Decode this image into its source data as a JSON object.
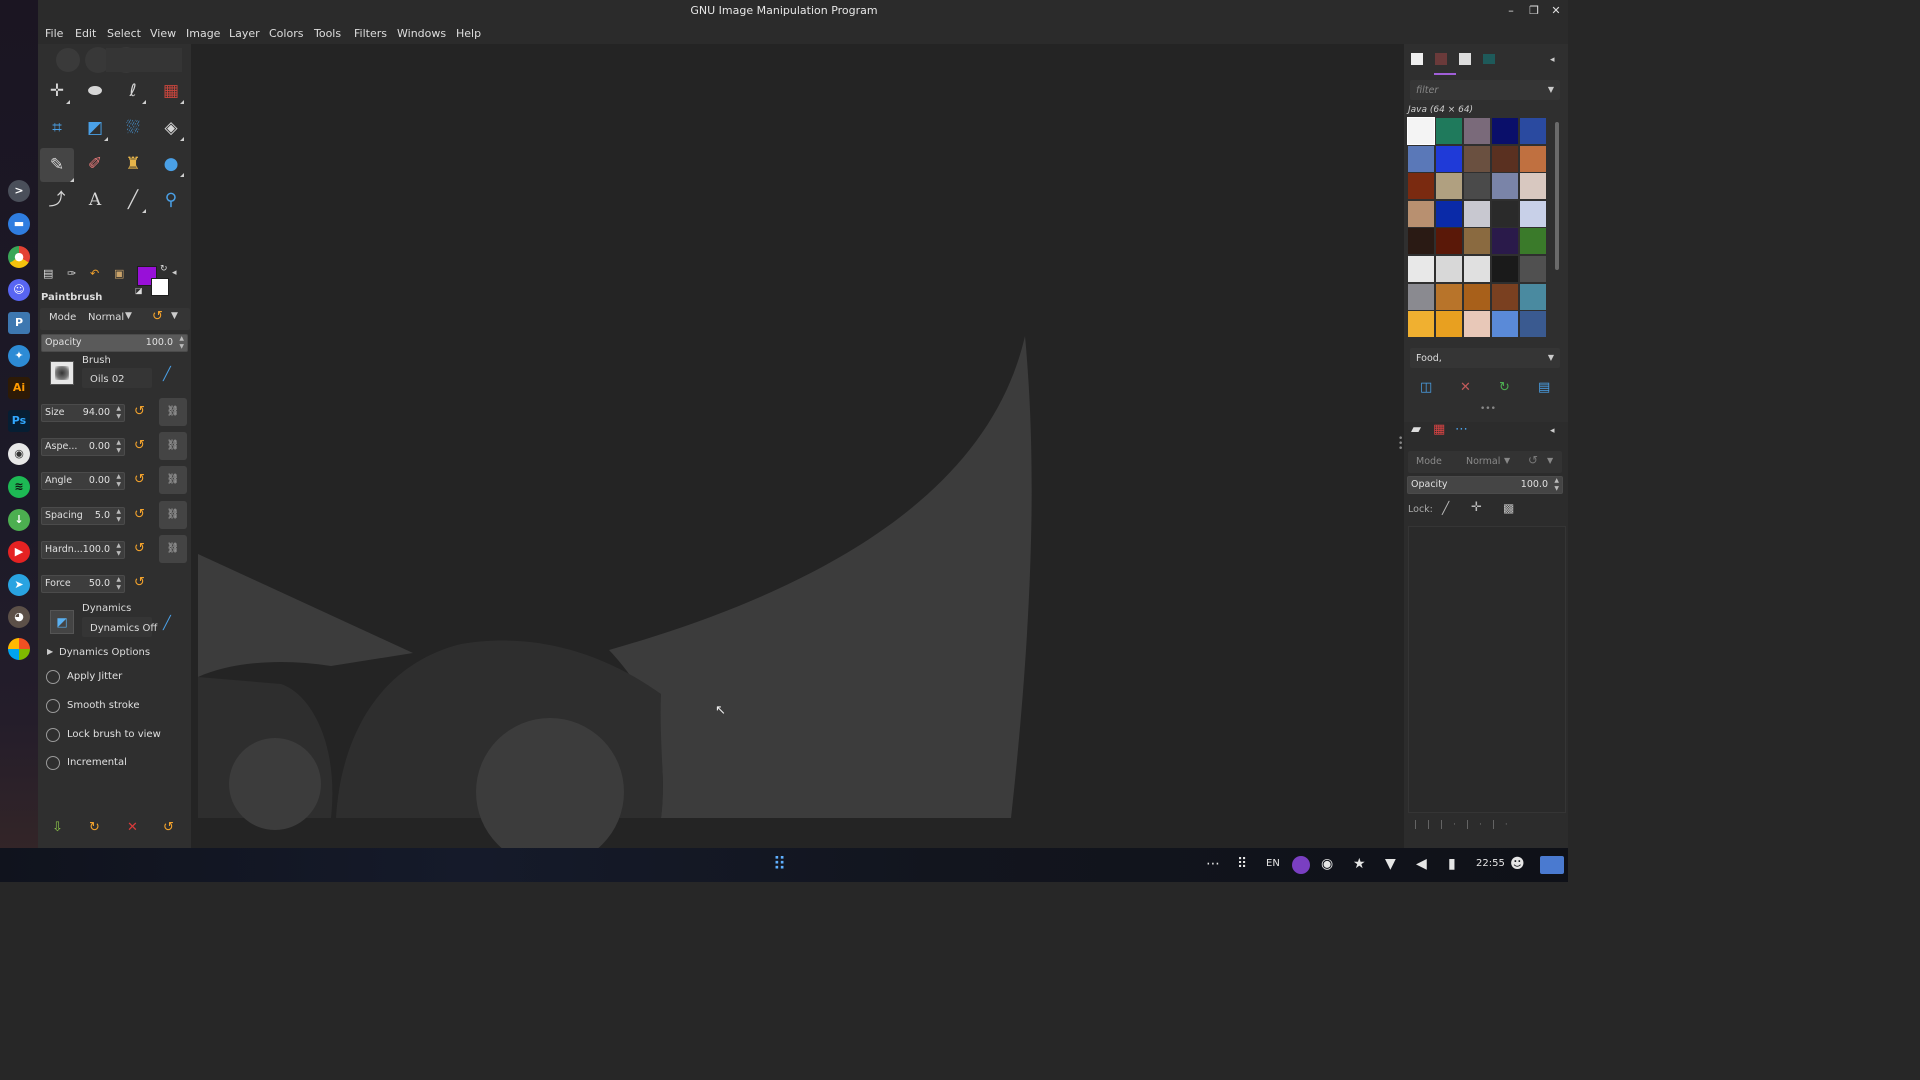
{
  "window": {
    "title": "GNU Image Manipulation Program",
    "controls": [
      "–",
      "❐",
      "✕"
    ]
  },
  "menu": [
    "File",
    "Edit",
    "Select",
    "View",
    "Image",
    "Layer",
    "Colors",
    "Tools",
    "Filters",
    "Windows",
    "Help"
  ],
  "toolbox": {
    "fg_color": "#9810d8",
    "bg_color": "#ffffff",
    "tools": [
      "move-tool",
      "ellipse-select-tool",
      "free-select-tool",
      "foreground-select-tool",
      "crop-tool",
      "unified-transform-tool",
      "warp-transform-tool",
      "perspective-tool",
      "paintbrush-tool",
      "eraser-tool",
      "clone-tool",
      "blur-tool",
      "paths-tool",
      "text-tool",
      "color-picker-tool",
      "zoom-tool"
    ]
  },
  "tool_options": {
    "title": "Paintbrush",
    "mode_label": "Mode",
    "mode_value": "Normal",
    "opacity_label": "Opacity",
    "opacity_value": "100.0",
    "brush_label": "Brush",
    "brush_name": "Oils 02",
    "params": [
      {
        "label": "Size",
        "value": "94.00"
      },
      {
        "label": "Aspe...",
        "value": "0.00"
      },
      {
        "label": "Angle",
        "value": "0.00"
      },
      {
        "label": "Spacing",
        "value": "5.0"
      },
      {
        "label": "Hardn...",
        "value": "100.0"
      },
      {
        "label": "Force",
        "value": "50.0"
      }
    ],
    "dynamics_label": "Dynamics",
    "dynamics_name": "Dynamics Off",
    "dynamics_options": "Dynamics Options",
    "checks": [
      "Apply Jitter",
      "Smooth stroke",
      "Lock brush to view",
      "Incremental"
    ]
  },
  "patterns": {
    "filter_placeholder": "filter",
    "selected_name": "Java (64 × 64)",
    "tag_value": "Food,"
  },
  "layers": {
    "mode_label": "Mode",
    "mode_value": "Normal",
    "opacity_label": "Opacity",
    "opacity_value": "100.0",
    "lock_label": "Lock:"
  },
  "taskbar": {
    "lang": "EN",
    "time": "22:55"
  }
}
